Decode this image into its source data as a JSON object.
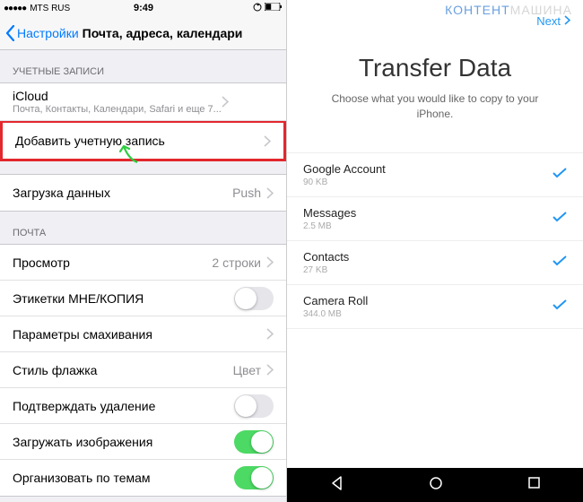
{
  "ios": {
    "status": {
      "carrier": "MTS RUS",
      "time": "9:49"
    },
    "back": "Настройки",
    "title": "Почта, адреса, календари",
    "section_accounts": "УЧЕТНЫЕ ЗАПИСИ",
    "icloud": {
      "title": "iCloud",
      "sub": "Почта, Контакты, Календари, Safari и еще 7..."
    },
    "add_account": "Добавить учетную запись",
    "fetch": {
      "label": "Загрузка данных",
      "value": "Push"
    },
    "section_mail": "ПОЧТА",
    "preview": {
      "label": "Просмотр",
      "value": "2 строки"
    },
    "tocc": "Этикетки МНЕ/КОПИЯ",
    "swipe": "Параметры смахивания",
    "flag": {
      "label": "Стиль флажка",
      "value": "Цвет"
    },
    "confirm_delete": "Подтверждать удаление",
    "load_images": "Загружать изображения",
    "organize": "Организовать по темам"
  },
  "android": {
    "watermark1": "КОНТЕНТ",
    "watermark2": "МАШИНА",
    "next": "Next",
    "title": "Transfer Data",
    "sub": "Choose what you would like to copy to your iPhone.",
    "items": [
      {
        "name": "Google Account",
        "size": "90 KB"
      },
      {
        "name": "Messages",
        "size": "2.5 MB"
      },
      {
        "name": "Contacts",
        "size": "27 KB"
      },
      {
        "name": "Camera Roll",
        "size": "344.0 MB"
      }
    ]
  }
}
